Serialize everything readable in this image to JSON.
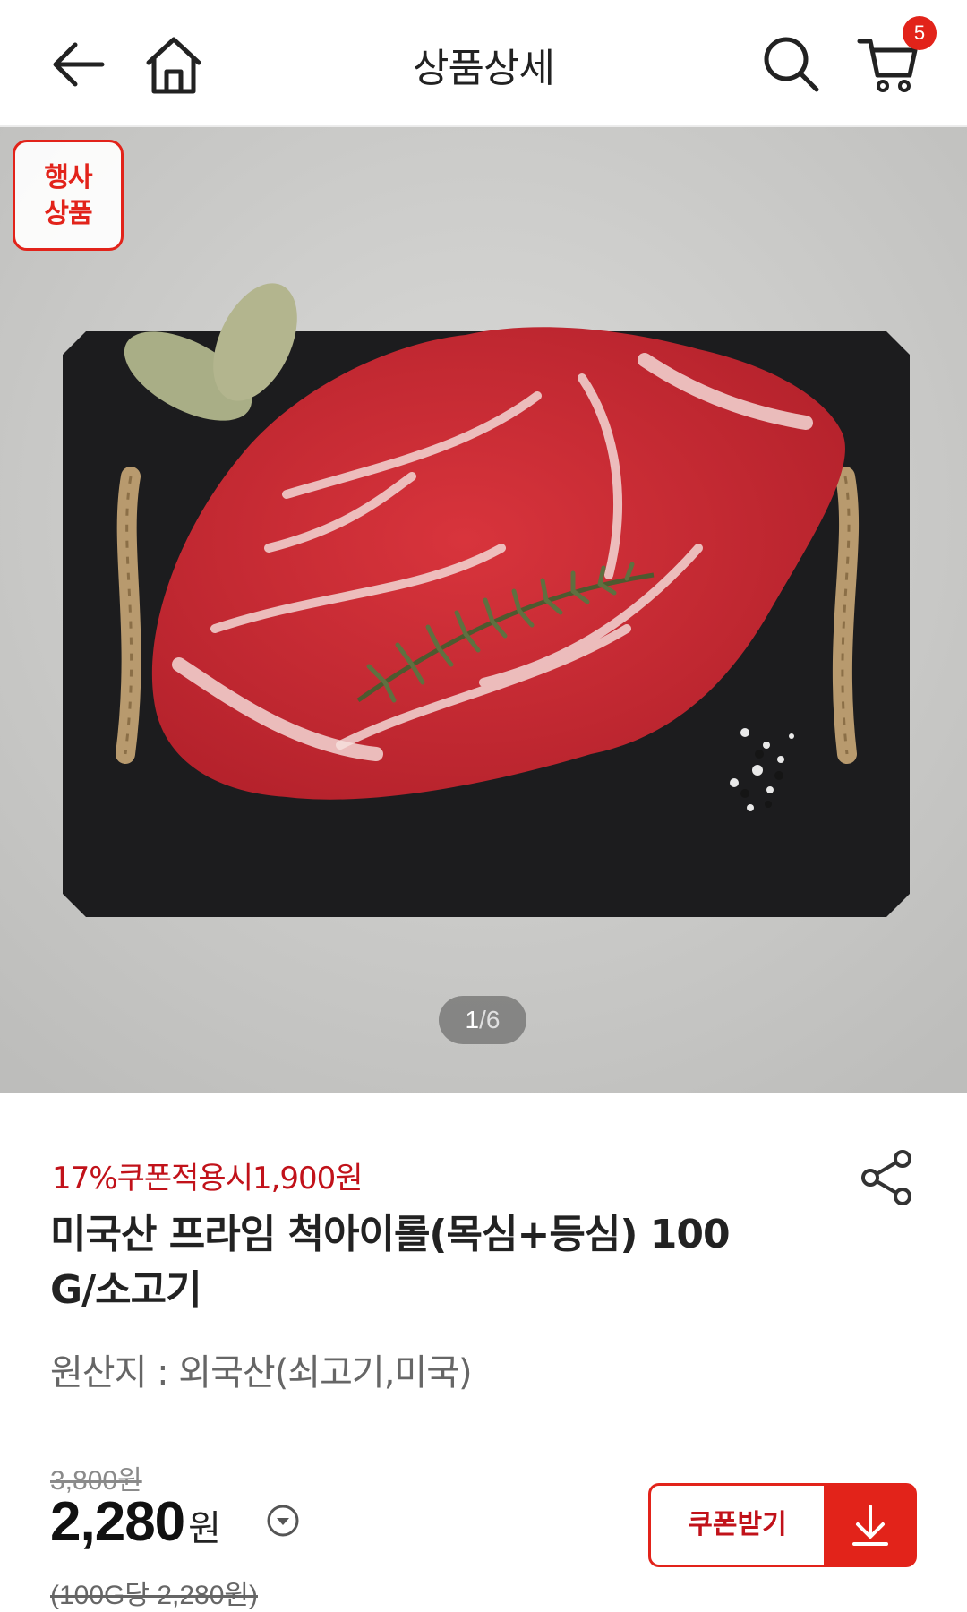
{
  "header": {
    "title": "상품상세",
    "back_icon": "arrow-left-icon",
    "home_icon": "home-icon",
    "search_icon": "search-icon",
    "cart_icon": "cart-icon",
    "cart_count": "5"
  },
  "gallery": {
    "event_tag_line1": "행사",
    "event_tag_line2": "상품",
    "current": "1",
    "separator": "/",
    "total": "6"
  },
  "product": {
    "coupon_text": "17%쿠폰적용시1,900원",
    "title": "미국산 프라임 척아이롤(목심+등심) 100 G/소고기",
    "origin": "원산지 : 외국산(쇠고기,미국)",
    "original_price": "3,800원",
    "price": "2,280",
    "price_unit": "원",
    "unit_price": "(100G당 2,280원)",
    "coupon_button_label": "쿠폰받기",
    "share_icon": "share-icon",
    "download_icon": "download-icon",
    "price_info_icon": "chevron-down-circle-icon"
  },
  "colors": {
    "accent": "#e2231a",
    "coupon_text": "#c1121a"
  }
}
